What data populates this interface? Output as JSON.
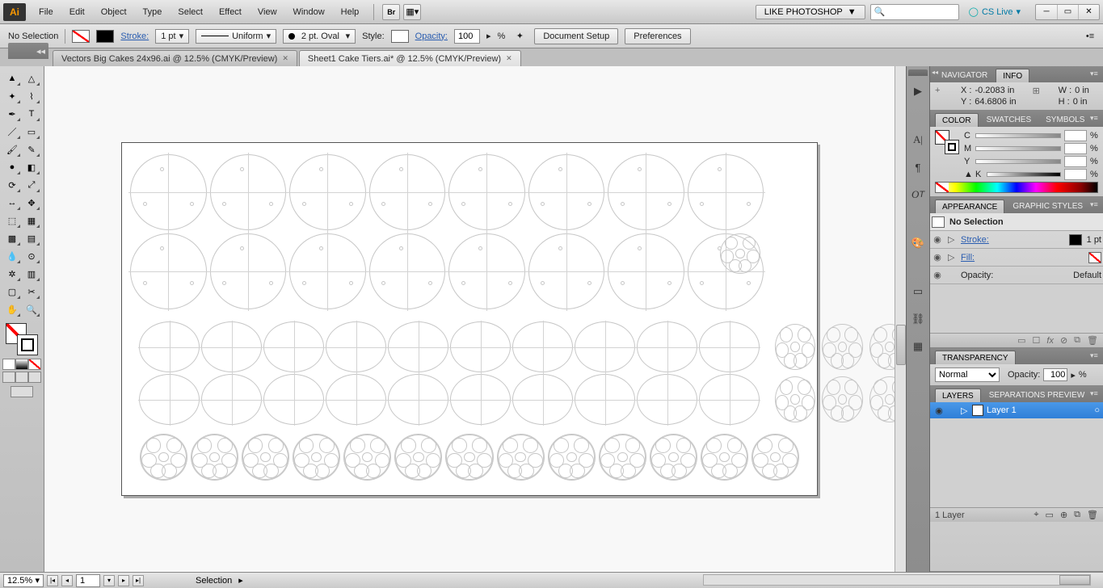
{
  "app": {
    "logo": "Ai"
  },
  "menu": {
    "items": [
      "File",
      "Edit",
      "Object",
      "Type",
      "Select",
      "Effect",
      "View",
      "Window",
      "Help"
    ]
  },
  "workspace": {
    "name": "LIKE PHOTOSHOP",
    "cs": "CS Live"
  },
  "control": {
    "selection": "No Selection",
    "stroke_label": "Stroke:",
    "stroke_weight": "1 pt",
    "brush": "Uniform",
    "profile": "2 pt. Oval",
    "style_label": "Style:",
    "opacity_label": "Opacity:",
    "opacity_value": "100",
    "opacity_pct": "%",
    "doc_setup": "Document Setup",
    "prefs": "Preferences"
  },
  "tabs": [
    {
      "title": "Vectors Big Cakes 24x96.ai @ 12.5% (CMYK/Preview)",
      "active": false
    },
    {
      "title": "Sheet1 Cake Tiers.ai* @ 12.5% (CMYK/Preview)",
      "active": true
    }
  ],
  "panels": {
    "info": {
      "tabs": [
        "NAVIGATOR",
        "INFO"
      ],
      "active": 1,
      "x_label": "X :",
      "x": "-0.2083 in",
      "y_label": "Y :",
      "y": "64.6806 in",
      "w_label": "W :",
      "w": "0 in",
      "h_label": "H :",
      "h": "0 in"
    },
    "color": {
      "tabs": [
        "COLOR",
        "SWATCHES",
        "SYMBOLS"
      ],
      "active": 0,
      "channels": [
        "C",
        "M",
        "Y",
        "K"
      ],
      "pct": "%"
    },
    "appearance": {
      "tabs": [
        "APPEARANCE",
        "GRAPHIC STYLES"
      ],
      "active": 0,
      "sel": "No Selection",
      "stroke_label": "Stroke:",
      "stroke_val": "1 pt",
      "fill_label": "Fill:",
      "opacity_label": "Opacity:",
      "opacity_val": "Default",
      "foot_icons": [
        "▭",
        "☐",
        "fx",
        "⊘",
        "⧉",
        "🗑"
      ]
    },
    "transparency": {
      "tabs": [
        "TRANSPARENCY"
      ],
      "mode": "Normal",
      "opacity_label": "Opacity:",
      "opacity_value": "100",
      "pct": "%"
    },
    "layers": {
      "tabs": [
        "LAYERS",
        "SEPARATIONS PREVIEW"
      ],
      "active": 0,
      "layer_name": "Layer 1",
      "count": "1 Layer"
    }
  },
  "status": {
    "zoom": "12.5%",
    "page": "1",
    "tool": "Selection"
  },
  "tools": [
    "selection",
    "direct-selection",
    "magic-wand",
    "lasso",
    "pen",
    "type",
    "line",
    "rectangle",
    "paintbrush",
    "pencil",
    "blob-brush",
    "eraser",
    "rotate",
    "scale",
    "width",
    "free-transform",
    "shape-builder",
    "perspective",
    "mesh",
    "gradient",
    "eyedropper",
    "blend",
    "symbol-sprayer",
    "column-graph",
    "artboard",
    "slice",
    "hand",
    "zoom"
  ],
  "dock_icons": [
    "play",
    "A-char",
    "paragraph",
    "opentype",
    "tool-guide",
    "doc-info",
    "link",
    "align"
  ]
}
